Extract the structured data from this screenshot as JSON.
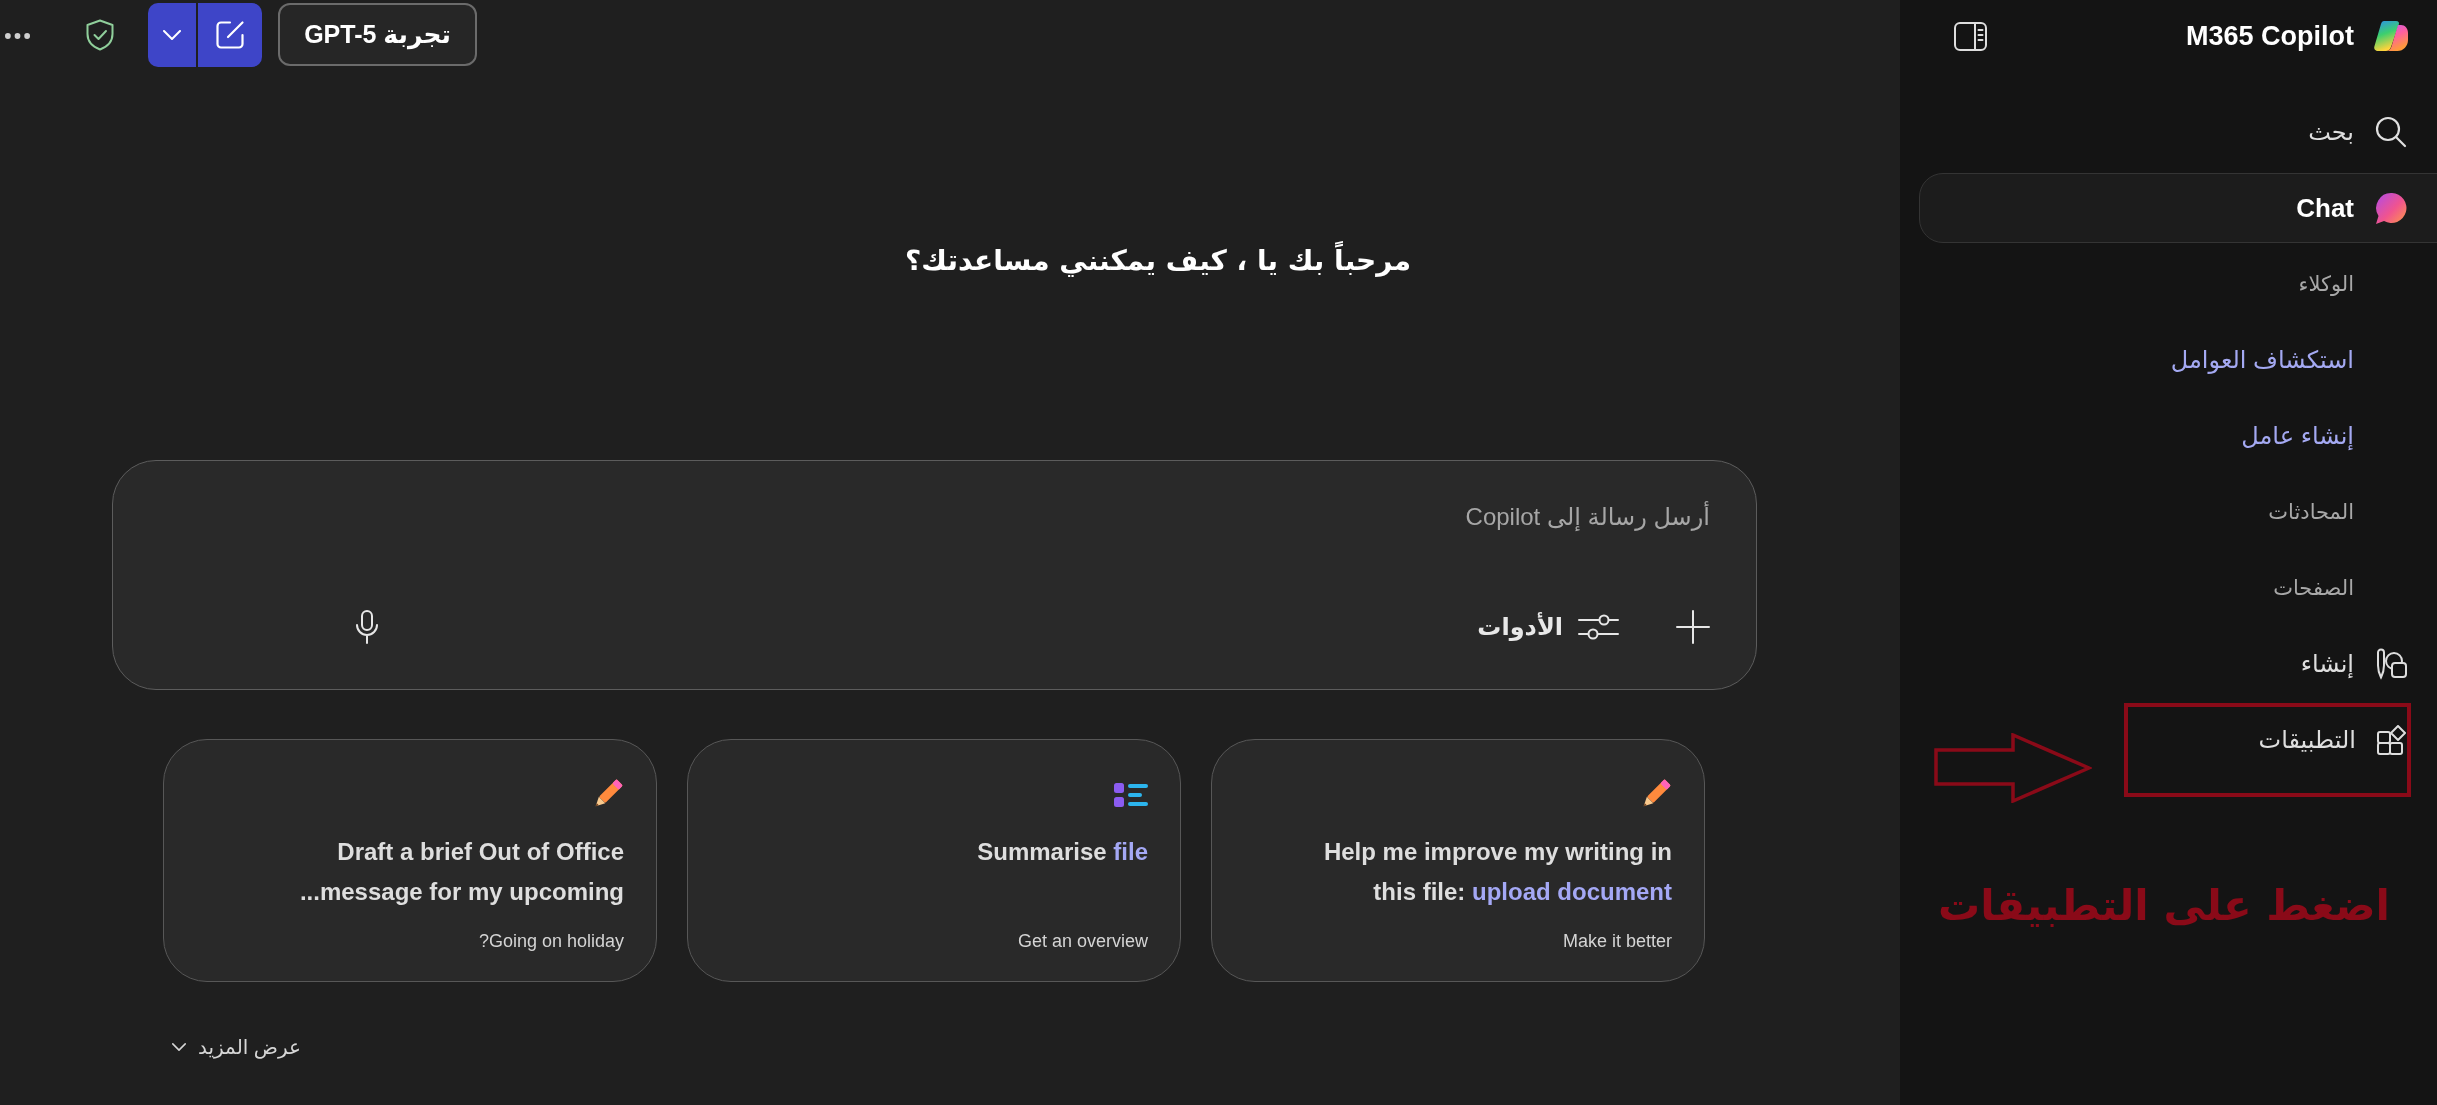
{
  "toolbar": {
    "model_button": "تجربة GPT-5"
  },
  "welcome": {
    "heading": "مرحباً بك يا ، كيف يمكنني مساعدتك؟"
  },
  "composer": {
    "placeholder": "أرسل رسالة إلى Copilot",
    "tools_label": "الأدوات"
  },
  "suggestions": [
    {
      "kind": "write",
      "title": "Help me improve my writing in\nthis file:",
      "link": "upload document",
      "subtitle": "Make it better"
    },
    {
      "kind": "summarise",
      "title": "Summarise",
      "link": "file",
      "subtitle": "Get an overview"
    },
    {
      "kind": "write",
      "title": "Draft a brief Out of Office\nmessage for my upcoming...",
      "subtitle": "Going on holiday?"
    }
  ],
  "show_more": {
    "label": "عرض المزيد"
  },
  "sidebar": {
    "title": "M365 Copilot",
    "items": [
      {
        "kind": "search",
        "label": "بحث",
        "selected": false,
        "highlighted": false
      },
      {
        "kind": "chat",
        "label": "Chat",
        "selected": true,
        "highlighted": false
      },
      {
        "kind": "section",
        "label": "الوكلاء",
        "selected": false,
        "highlighted": false
      },
      {
        "kind": "link",
        "label": "استكشاف العوامل",
        "selected": false,
        "highlighted": false
      },
      {
        "kind": "link",
        "label": "إنشاء عامل",
        "selected": false,
        "highlighted": false
      },
      {
        "kind": "section",
        "label": "المحادثات",
        "selected": false,
        "highlighted": false
      },
      {
        "kind": "section",
        "label": "الصفحات",
        "selected": false,
        "highlighted": false
      },
      {
        "kind": "create",
        "label": "إنشاء",
        "selected": false,
        "highlighted": false
      },
      {
        "kind": "apps",
        "label": "التطبيقات",
        "selected": false,
        "highlighted": true
      }
    ]
  },
  "annotation": {
    "text": "اضغط على التطبيقات"
  }
}
